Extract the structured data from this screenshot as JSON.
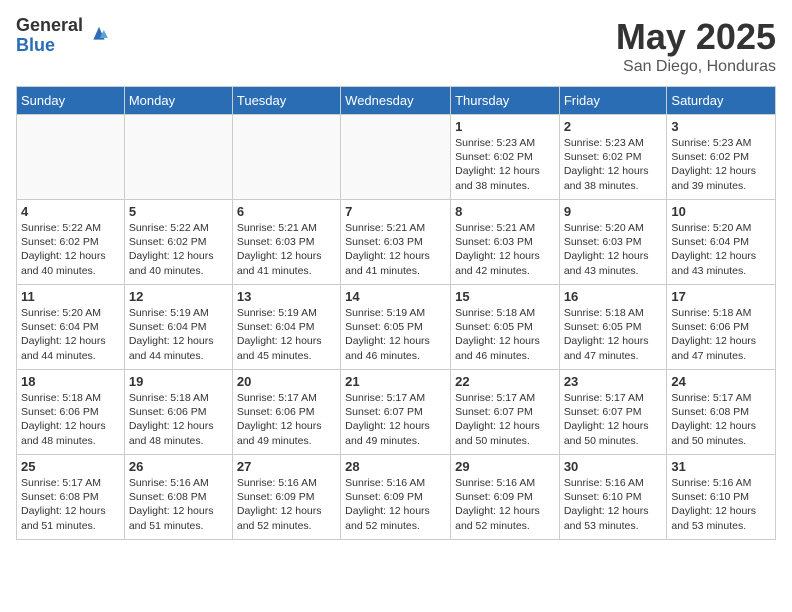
{
  "header": {
    "logo_general": "General",
    "logo_blue": "Blue",
    "month_title": "May 2025",
    "location": "San Diego, Honduras"
  },
  "days_of_week": [
    "Sunday",
    "Monday",
    "Tuesday",
    "Wednesday",
    "Thursday",
    "Friday",
    "Saturday"
  ],
  "weeks": [
    [
      {
        "day": "",
        "info": ""
      },
      {
        "day": "",
        "info": ""
      },
      {
        "day": "",
        "info": ""
      },
      {
        "day": "",
        "info": ""
      },
      {
        "day": "1",
        "info": "Sunrise: 5:23 AM\nSunset: 6:02 PM\nDaylight: 12 hours\nand 38 minutes."
      },
      {
        "day": "2",
        "info": "Sunrise: 5:23 AM\nSunset: 6:02 PM\nDaylight: 12 hours\nand 38 minutes."
      },
      {
        "day": "3",
        "info": "Sunrise: 5:23 AM\nSunset: 6:02 PM\nDaylight: 12 hours\nand 39 minutes."
      }
    ],
    [
      {
        "day": "4",
        "info": "Sunrise: 5:22 AM\nSunset: 6:02 PM\nDaylight: 12 hours\nand 40 minutes."
      },
      {
        "day": "5",
        "info": "Sunrise: 5:22 AM\nSunset: 6:02 PM\nDaylight: 12 hours\nand 40 minutes."
      },
      {
        "day": "6",
        "info": "Sunrise: 5:21 AM\nSunset: 6:03 PM\nDaylight: 12 hours\nand 41 minutes."
      },
      {
        "day": "7",
        "info": "Sunrise: 5:21 AM\nSunset: 6:03 PM\nDaylight: 12 hours\nand 41 minutes."
      },
      {
        "day": "8",
        "info": "Sunrise: 5:21 AM\nSunset: 6:03 PM\nDaylight: 12 hours\nand 42 minutes."
      },
      {
        "day": "9",
        "info": "Sunrise: 5:20 AM\nSunset: 6:03 PM\nDaylight: 12 hours\nand 43 minutes."
      },
      {
        "day": "10",
        "info": "Sunrise: 5:20 AM\nSunset: 6:04 PM\nDaylight: 12 hours\nand 43 minutes."
      }
    ],
    [
      {
        "day": "11",
        "info": "Sunrise: 5:20 AM\nSunset: 6:04 PM\nDaylight: 12 hours\nand 44 minutes."
      },
      {
        "day": "12",
        "info": "Sunrise: 5:19 AM\nSunset: 6:04 PM\nDaylight: 12 hours\nand 44 minutes."
      },
      {
        "day": "13",
        "info": "Sunrise: 5:19 AM\nSunset: 6:04 PM\nDaylight: 12 hours\nand 45 minutes."
      },
      {
        "day": "14",
        "info": "Sunrise: 5:19 AM\nSunset: 6:05 PM\nDaylight: 12 hours\nand 46 minutes."
      },
      {
        "day": "15",
        "info": "Sunrise: 5:18 AM\nSunset: 6:05 PM\nDaylight: 12 hours\nand 46 minutes."
      },
      {
        "day": "16",
        "info": "Sunrise: 5:18 AM\nSunset: 6:05 PM\nDaylight: 12 hours\nand 47 minutes."
      },
      {
        "day": "17",
        "info": "Sunrise: 5:18 AM\nSunset: 6:06 PM\nDaylight: 12 hours\nand 47 minutes."
      }
    ],
    [
      {
        "day": "18",
        "info": "Sunrise: 5:18 AM\nSunset: 6:06 PM\nDaylight: 12 hours\nand 48 minutes."
      },
      {
        "day": "19",
        "info": "Sunrise: 5:18 AM\nSunset: 6:06 PM\nDaylight: 12 hours\nand 48 minutes."
      },
      {
        "day": "20",
        "info": "Sunrise: 5:17 AM\nSunset: 6:06 PM\nDaylight: 12 hours\nand 49 minutes."
      },
      {
        "day": "21",
        "info": "Sunrise: 5:17 AM\nSunset: 6:07 PM\nDaylight: 12 hours\nand 49 minutes."
      },
      {
        "day": "22",
        "info": "Sunrise: 5:17 AM\nSunset: 6:07 PM\nDaylight: 12 hours\nand 50 minutes."
      },
      {
        "day": "23",
        "info": "Sunrise: 5:17 AM\nSunset: 6:07 PM\nDaylight: 12 hours\nand 50 minutes."
      },
      {
        "day": "24",
        "info": "Sunrise: 5:17 AM\nSunset: 6:08 PM\nDaylight: 12 hours\nand 50 minutes."
      }
    ],
    [
      {
        "day": "25",
        "info": "Sunrise: 5:17 AM\nSunset: 6:08 PM\nDaylight: 12 hours\nand 51 minutes."
      },
      {
        "day": "26",
        "info": "Sunrise: 5:16 AM\nSunset: 6:08 PM\nDaylight: 12 hours\nand 51 minutes."
      },
      {
        "day": "27",
        "info": "Sunrise: 5:16 AM\nSunset: 6:09 PM\nDaylight: 12 hours\nand 52 minutes."
      },
      {
        "day": "28",
        "info": "Sunrise: 5:16 AM\nSunset: 6:09 PM\nDaylight: 12 hours\nand 52 minutes."
      },
      {
        "day": "29",
        "info": "Sunrise: 5:16 AM\nSunset: 6:09 PM\nDaylight: 12 hours\nand 52 minutes."
      },
      {
        "day": "30",
        "info": "Sunrise: 5:16 AM\nSunset: 6:10 PM\nDaylight: 12 hours\nand 53 minutes."
      },
      {
        "day": "31",
        "info": "Sunrise: 5:16 AM\nSunset: 6:10 PM\nDaylight: 12 hours\nand 53 minutes."
      }
    ]
  ]
}
